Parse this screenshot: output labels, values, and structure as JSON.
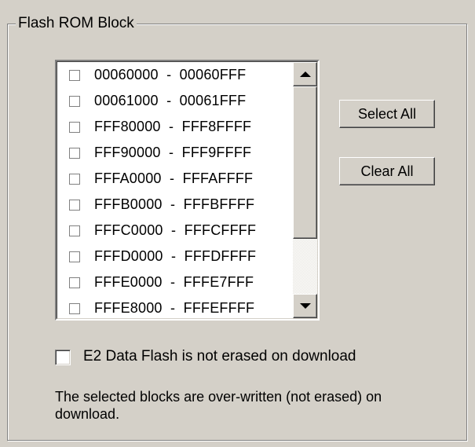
{
  "group": {
    "title": "Flash ROM Block"
  },
  "blocks": [
    {
      "label": "00060000  -  00060FFF",
      "checked": false
    },
    {
      "label": "00061000  -  00061FFF",
      "checked": false
    },
    {
      "label": "FFF80000  -  FFF8FFFF",
      "checked": false
    },
    {
      "label": "FFF90000  -  FFF9FFFF",
      "checked": false
    },
    {
      "label": "FFFA0000  -  FFFAFFFF",
      "checked": false
    },
    {
      "label": "FFFB0000  -  FFFBFFFF",
      "checked": false
    },
    {
      "label": "FFFC0000  -  FFFCFFFF",
      "checked": false
    },
    {
      "label": "FFFD0000  -  FFFDFFFF",
      "checked": false
    },
    {
      "label": "FFFE0000  -  FFFE7FFF",
      "checked": false
    },
    {
      "label": "FFFE8000  -  FFFEFFFF",
      "checked": false
    }
  ],
  "buttons": {
    "select_all": "Select All",
    "clear_all": "Clear All"
  },
  "e2_flash": {
    "label": "E2 Data Flash is not erased on download",
    "checked": false
  },
  "note": "The selected blocks are over-written (not erased) on download.",
  "colors": {
    "face": "#d4d0c8",
    "window": "#ffffff",
    "shadow": "#808080"
  }
}
